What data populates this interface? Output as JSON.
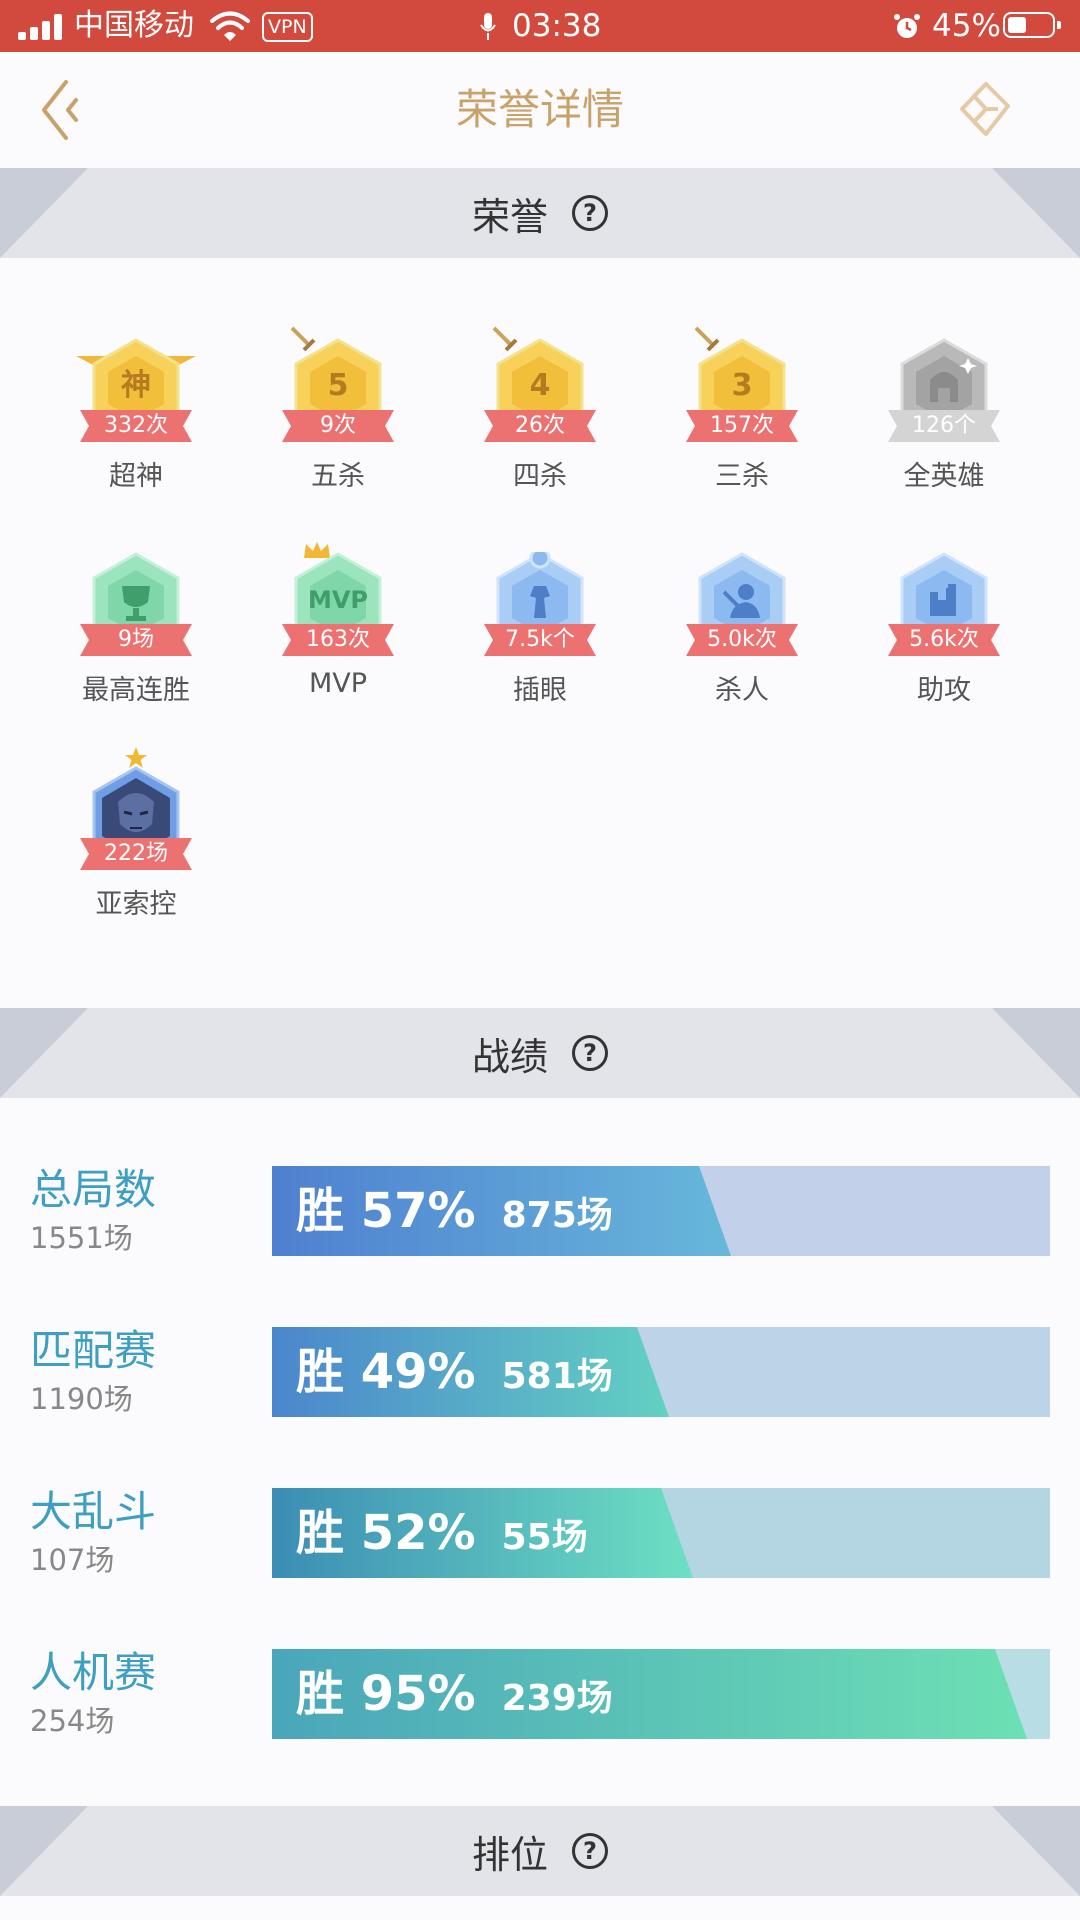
{
  "status_bar": {
    "carrier": "中国移动",
    "vpn": "VPN",
    "time": "03:38",
    "battery_percent": "45%",
    "battery_level": 0.45
  },
  "nav": {
    "title": "荣誉详情",
    "back_icon": "double-chevron-left-icon",
    "share_icon": "share-icon"
  },
  "sections": {
    "honor": "荣誉",
    "record": "战绩",
    "rank": "排位",
    "help_glyph": "?"
  },
  "badges": [
    {
      "name": "超神",
      "count": "332次",
      "glyph": "神",
      "icon": "godlike-badge-icon",
      "color": "gold"
    },
    {
      "name": "五杀",
      "count": "9次",
      "glyph": "5",
      "icon": "penta-kill-badge-icon",
      "color": "gold"
    },
    {
      "name": "四杀",
      "count": "26次",
      "glyph": "4",
      "icon": "quadra-kill-badge-icon",
      "color": "gold"
    },
    {
      "name": "三杀",
      "count": "157次",
      "glyph": "3",
      "icon": "triple-kill-badge-icon",
      "color": "gold"
    },
    {
      "name": "全英雄",
      "count": "126个",
      "glyph": "",
      "icon": "all-heroes-helmet-icon",
      "color": "gray"
    },
    {
      "name": "最高连胜",
      "count": "9场",
      "glyph": "",
      "icon": "trophy-icon",
      "color": "green"
    },
    {
      "name": "MVP",
      "count": "163次",
      "glyph": "MVP",
      "icon": "mvp-badge-icon",
      "color": "green"
    },
    {
      "name": "插眼",
      "count": "7.5k个",
      "glyph": "",
      "icon": "ward-icon",
      "color": "blue"
    },
    {
      "name": "杀人",
      "count": "5.0k次",
      "glyph": "",
      "icon": "kill-icon",
      "color": "blue"
    },
    {
      "name": "助攻",
      "count": "5.6k次",
      "glyph": "",
      "icon": "assist-fist-icon",
      "color": "blue"
    },
    {
      "name": "亚索控",
      "count": "222场",
      "glyph": "",
      "icon": "hero-yasuo-portrait-icon",
      "color": "hero"
    }
  ],
  "stats": [
    {
      "label": "总局数",
      "count": "1551场",
      "win_label": "胜 57%",
      "wins": "875场",
      "win_rate": 0.57,
      "colors": [
        "#4f7fd0",
        "#67b8db"
      ],
      "track": "#c2d0ea"
    },
    {
      "label": "匹配赛",
      "count": "1190场",
      "win_label": "胜 49%",
      "wins": "581场",
      "win_rate": 0.49,
      "colors": [
        "#4b86cd",
        "#63d1c2"
      ],
      "track": "#bcd3e8"
    },
    {
      "label": "大乱斗",
      "count": "107场",
      "win_label": "胜 52%",
      "wins": "55场",
      "win_rate": 0.52,
      "colors": [
        "#3b8db4",
        "#6ee0c4"
      ],
      "track": "#b4d5e2"
    },
    {
      "label": "人机赛",
      "count": "254场",
      "win_label": "胜 95%",
      "wins": "239场",
      "win_rate": 0.95,
      "colors": [
        "#4aa6ba",
        "#6de0b4"
      ],
      "track": "#b9dde4"
    }
  ]
}
